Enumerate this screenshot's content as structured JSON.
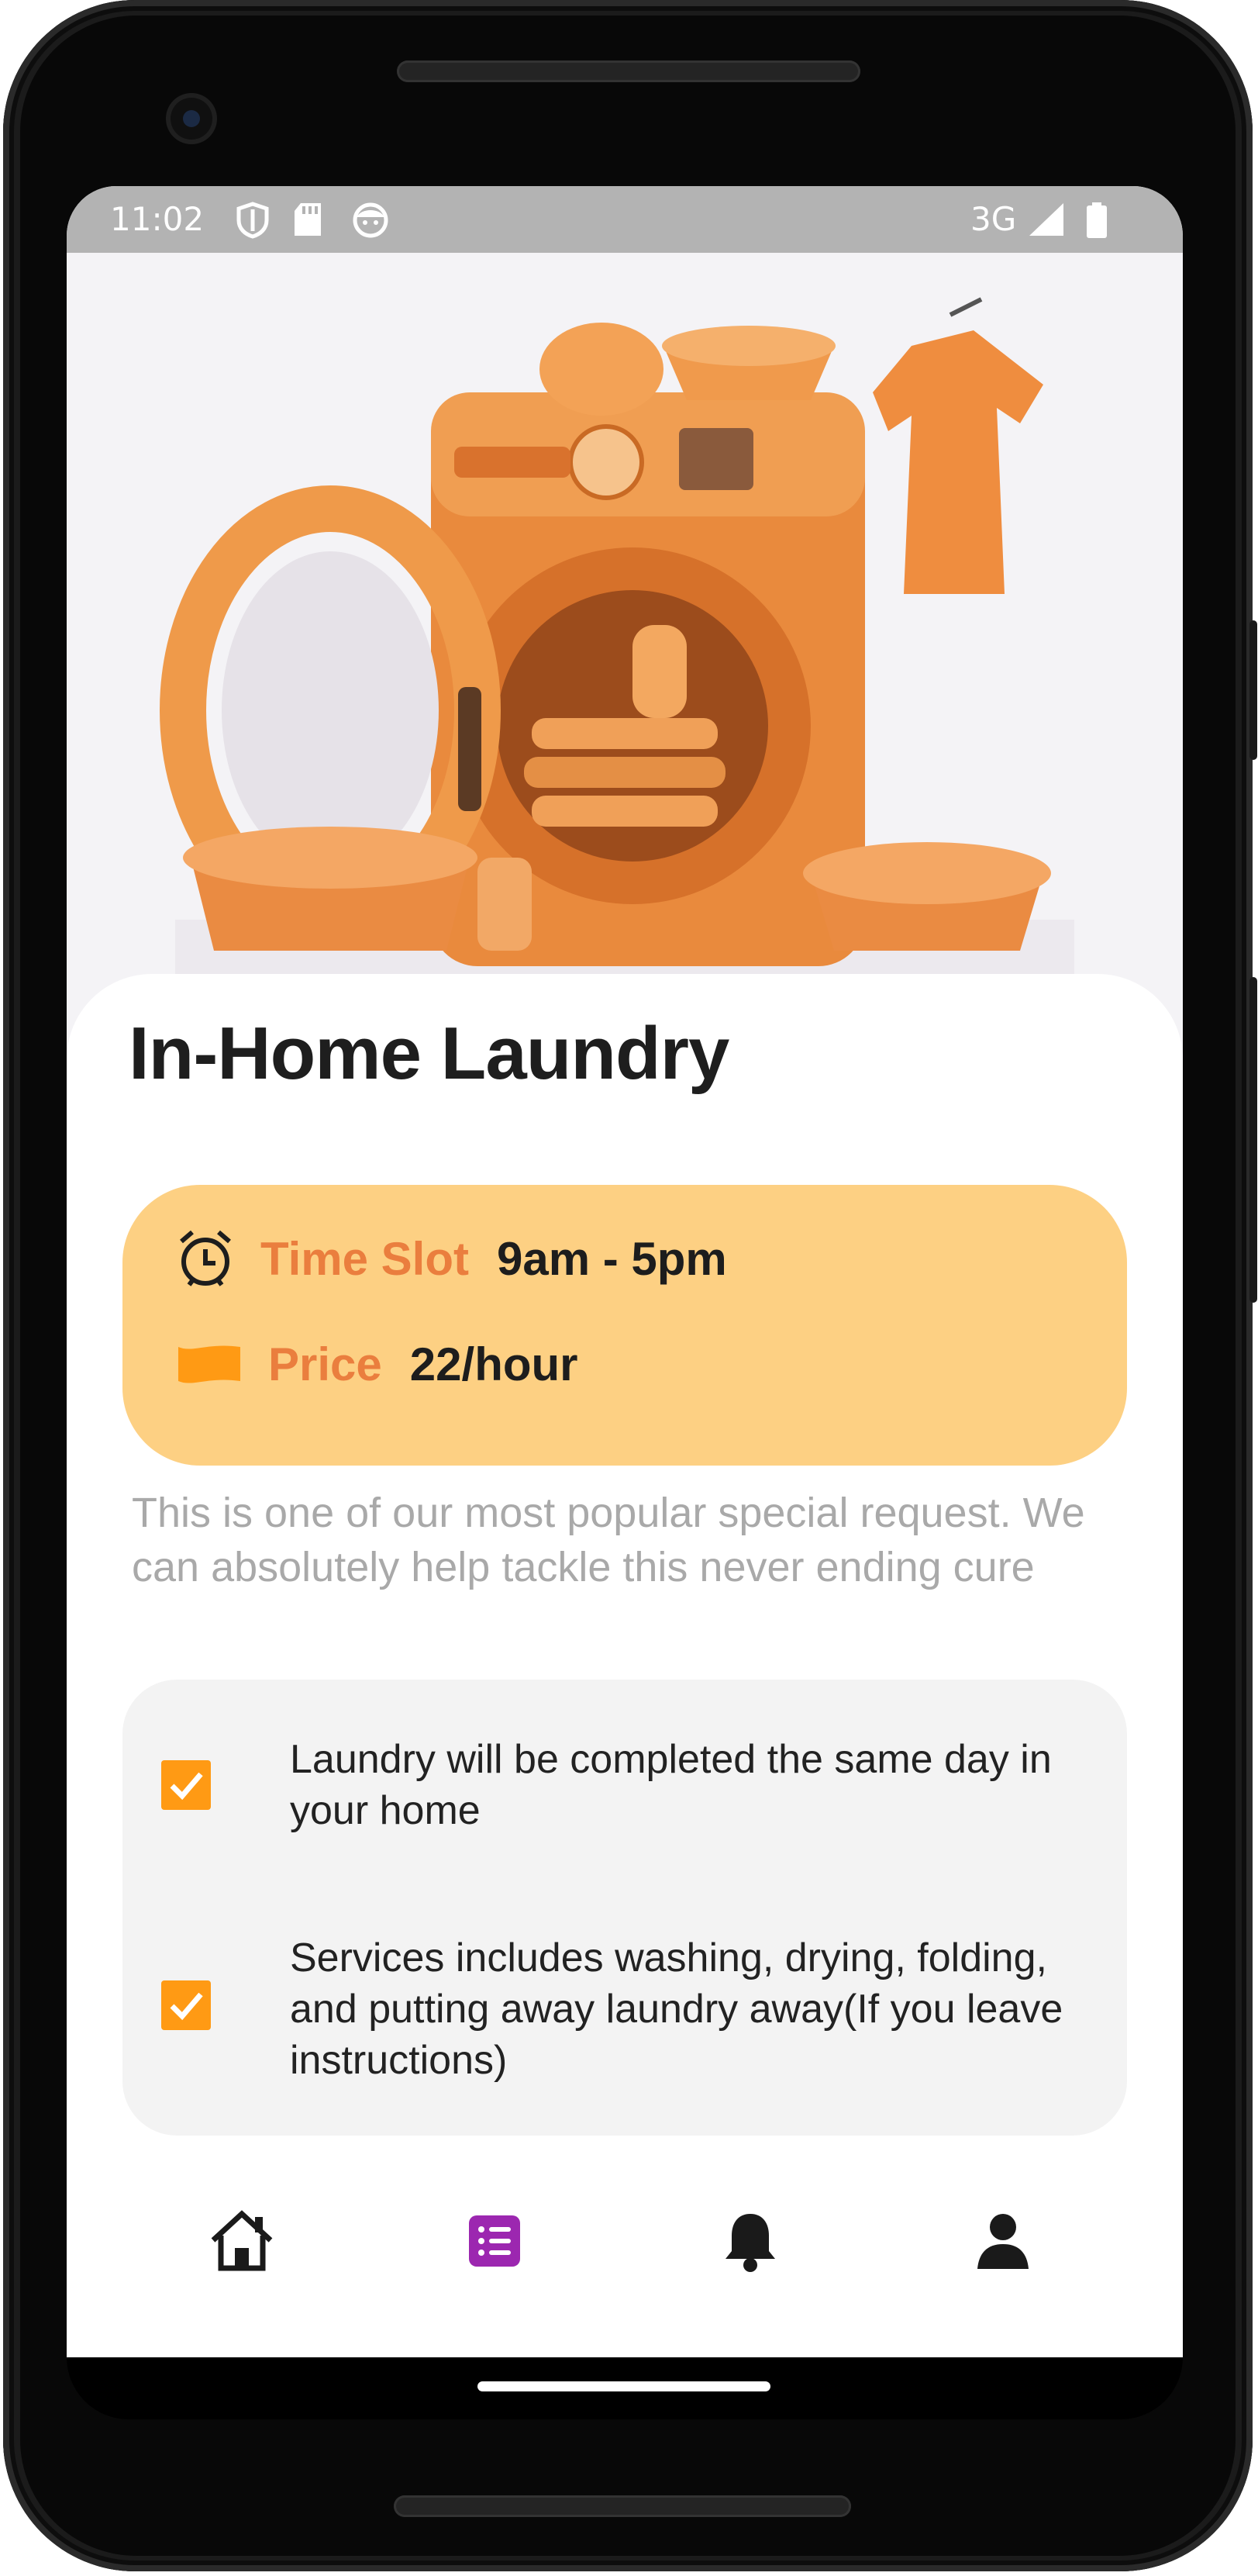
{
  "status_bar": {
    "time": "11:02",
    "network": "3G",
    "icons": [
      "shield-icon",
      "sd-card-icon",
      "face-icon",
      "signal-icon",
      "battery-icon"
    ]
  },
  "hero": {
    "image": "laundry-machine-illustration"
  },
  "service": {
    "title": "In-Home Laundry",
    "time_slot_label": "Time Slot",
    "time_slot_value": "9am - 5pm",
    "price_label": "Price",
    "price_value": "22/hour",
    "description": "This is one of our most popular special request. We can absolutely help tackle this never ending cure",
    "features": [
      {
        "text": "Laundry will be completed the same day in your home",
        "checked": true
      },
      {
        "text": "Services includes washing, drying, folding, and putting away laundry away(If you leave instructions)",
        "checked": true
      }
    ]
  },
  "bottom_nav": {
    "items": [
      "home-icon",
      "list-icon",
      "bell-icon",
      "profile-icon"
    ],
    "active_index": 1
  },
  "colors": {
    "accent_orange": "#ea7e3e",
    "card_bg": "#fdd083",
    "checkbox": "#ff9a14",
    "nav_active": "#9c27b0"
  }
}
